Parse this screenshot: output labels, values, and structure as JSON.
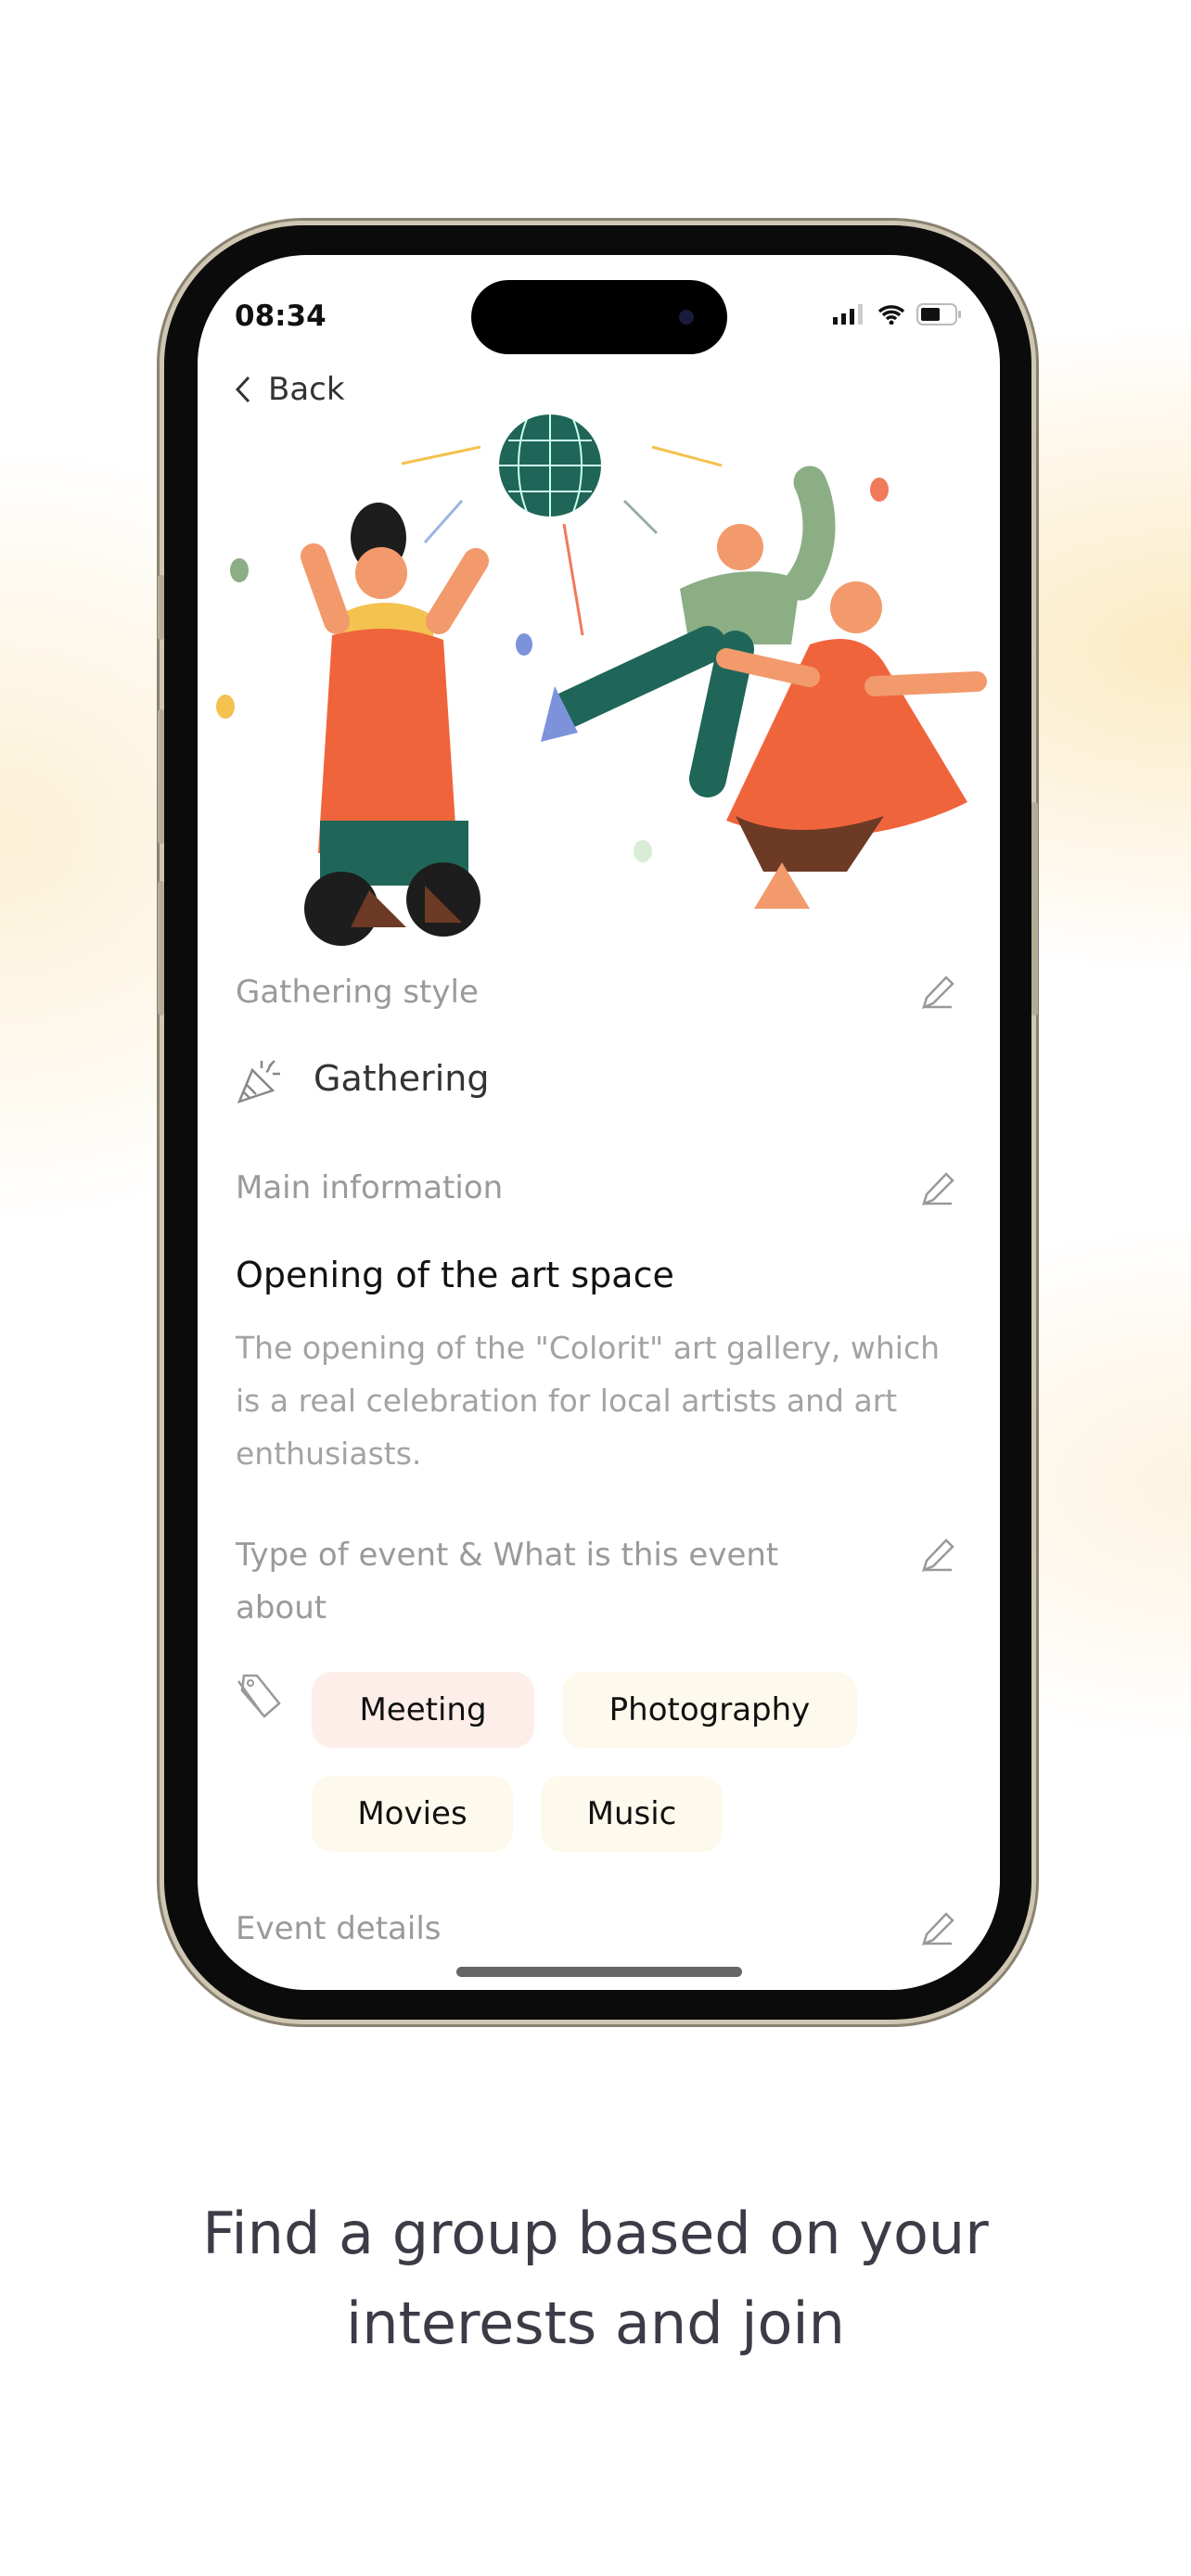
{
  "status_bar": {
    "time": "08:34"
  },
  "nav": {
    "back_label": "Back"
  },
  "gathering_style": {
    "label": "Gathering style",
    "value": "Gathering"
  },
  "main_information": {
    "label": "Main information",
    "title": "Opening of the art space",
    "description": "The opening of the \"Colorit\" art gallery, which is a real celebration for local artists and art enthusiasts."
  },
  "event_type": {
    "label": "Type of event & What is this event about",
    "tags": [
      {
        "label": "Meeting",
        "color": "#fdeeea"
      },
      {
        "label": "Photography",
        "color": "#fdf9ec"
      },
      {
        "label": "Movies",
        "color": "#fdf9ec"
      },
      {
        "label": "Music",
        "color": "#fdf9ec"
      }
    ]
  },
  "event_details": {
    "label": "Event details"
  },
  "caption": {
    "line1": "Find a group based on your",
    "line2": "interests and join"
  }
}
